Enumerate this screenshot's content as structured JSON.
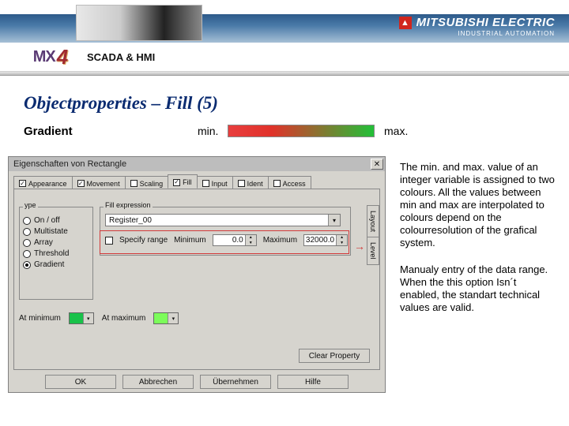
{
  "brand": {
    "name": "MITSUBISHI ELECTRIC",
    "sub": "INDUSTRIAL AUTOMATION",
    "logo_glyph": "▲"
  },
  "product": {
    "prefix": "MX",
    "num": "4",
    "tagline": "SCADA & HMI"
  },
  "title": "Objectproperties – Fill (5)",
  "labels": {
    "gradient": "Gradient",
    "min": "min.",
    "max": "max."
  },
  "dialog": {
    "title": "Eigenschaften von Rectangle",
    "close_glyph": "✕",
    "tabs": {
      "appearance": "Appearance",
      "movement": "Movement",
      "scaling": "Scaling",
      "fill": "Fill",
      "input": "Input",
      "ident": "Ident",
      "access": "Access",
      "check": "✓"
    },
    "type": {
      "legend": "ype",
      "items": [
        "On / off",
        "Multistate",
        "Array",
        "Threshold",
        "Gradient"
      ],
      "selected": "Gradient"
    },
    "fillgroup": {
      "legend": "Fill expression",
      "register": "Register_00",
      "arrow": "▾",
      "specify": "Specify range",
      "min_label": "Minimum",
      "min_value": "0.0",
      "max_label": "Maximum",
      "max_value": "32000.0",
      "up": "▲",
      "dn": "▼"
    },
    "colors": {
      "atmin_label": "At minimum",
      "atmin_color": "#19c24a",
      "atmax_label": "At maximum",
      "atmax_color": "#7CFC5a",
      "arrow": "▾"
    },
    "vtabs": {
      "layout": "Layout",
      "level": "Level"
    },
    "clear": "Clear Property",
    "buttons": {
      "ok": "OK",
      "cancel": "Abbrechen",
      "apply": "Übernehmen",
      "help": "Hilfe"
    }
  },
  "explain": {
    "p1": "The min. and max. value of an integer variable is assigned to two colours. All the values between min and max are interpolated to colours depend on the colourresolution of the grafical system.",
    "p2": "Manualy entry of the data range. When the this option Isn´t enabled, the standart technical values are valid."
  }
}
